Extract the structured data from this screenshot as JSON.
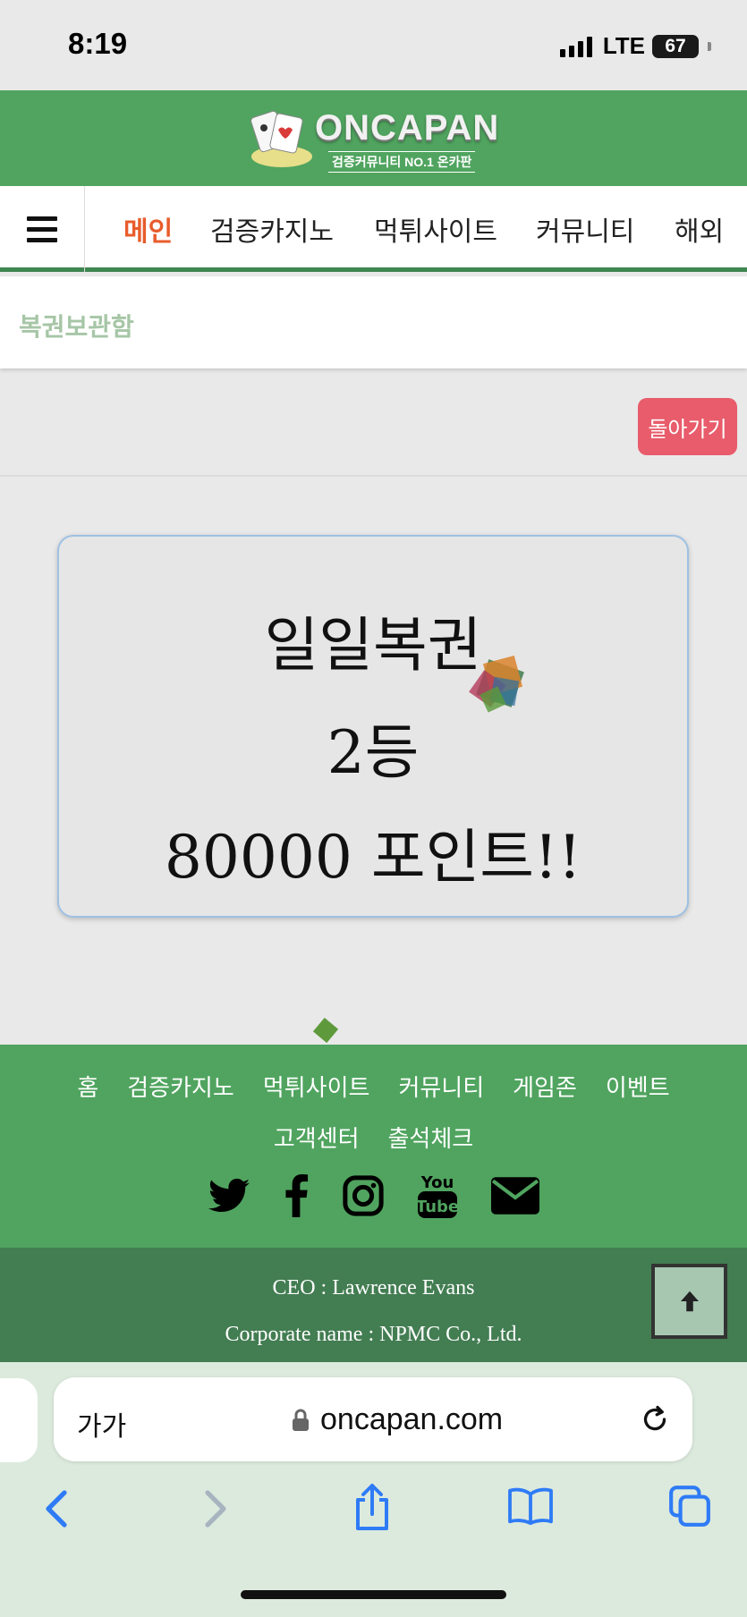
{
  "status_bar": {
    "time": "8:19",
    "network": "LTE",
    "battery": "67"
  },
  "header": {
    "logo_text": "ONCAPAN",
    "logo_sub": "검증커뮤니티 NO.1 온카판"
  },
  "nav": {
    "menu_icon": "hamburger-icon",
    "items": [
      "메인",
      "검증카지노",
      "먹튀사이트",
      "커뮤니티",
      "해외"
    ]
  },
  "page": {
    "title": "복권보관함",
    "back_label": "돌아가기"
  },
  "prize": {
    "title": "일일복권",
    "rank": "2등",
    "amount": "80000 포인트!!"
  },
  "footer": {
    "links_row1": [
      "홈",
      "검증카지노",
      "먹튀사이트",
      "커뮤니티",
      "게임존",
      "이벤트"
    ],
    "links_row2": [
      "고객센터",
      "출석체크"
    ],
    "social_icons": [
      "twitter-icon",
      "facebook-icon",
      "instagram-icon",
      "youtube-icon",
      "mail-icon"
    ],
    "ceo": "CEO : Lawrence Evans",
    "corporate": "Corporate name : NPMC Co., Ltd."
  },
  "browser": {
    "aa_label": "가가",
    "url": "oncapan.com"
  },
  "colors": {
    "header_green": "#50a45f",
    "footer_dark": "#437d52",
    "accent_orange": "#e85c2b",
    "back_button": "#e85c6b"
  }
}
